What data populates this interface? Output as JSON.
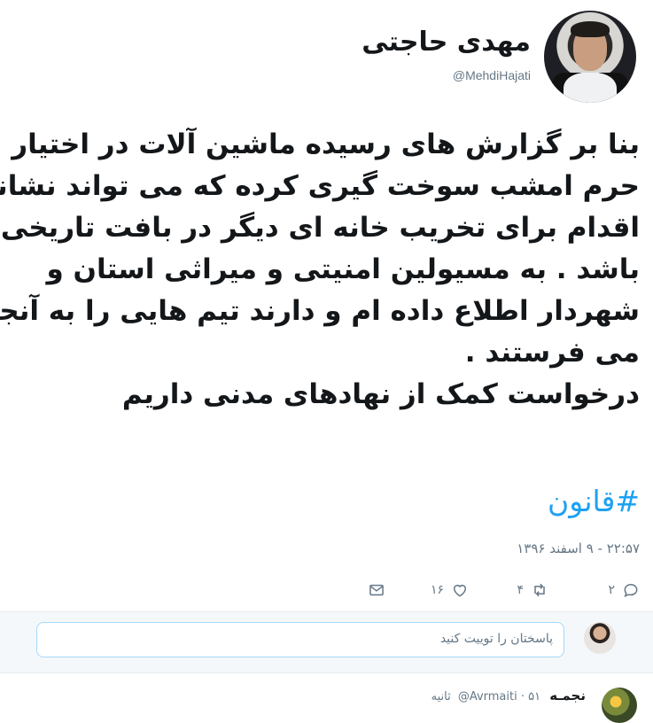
{
  "tweet": {
    "display_name": "مهدی حاجتی",
    "handle": "@MehdiHajati",
    "body_lines": [
      "بنا بر گزارش های رسیده ماشین آلات در اختیار",
      "حرم امشب سوخت گیری کرده که می تواند نشانه",
      "اقدام برای تخریب خانه ای دیگر در بافت تاریخی",
      "باشد . به مسیولین امنیتی و میراثی استان و",
      "شهردار اطلاع داده ام و دارند تیم هایی را به آنجا",
      "می فرستند .",
      "درخواست کمک از نهادهای مدنی داریم"
    ],
    "hashtag": "#قانون",
    "timestamp": "۲۲:۵۷ - ۹ اسفند ۱۳۹۶",
    "actions": {
      "reply_count": "۲",
      "retweet_count": "۴",
      "like_count": "۱۶",
      "reply_icon": "reply-icon",
      "retweet_icon": "retweet-icon",
      "like_icon": "heart-icon",
      "dm_icon": "envelope-icon"
    }
  },
  "reply_box": {
    "placeholder": "پاسختان را توییت کنید"
  },
  "next_tweet": {
    "name": "نجمـه",
    "handle": "@Avrmaiti",
    "time": "۵۱ ثانیه"
  },
  "colors": {
    "link_blue": "#1da1f2",
    "secondary_text": "#657786",
    "primary_text": "#14171a"
  }
}
